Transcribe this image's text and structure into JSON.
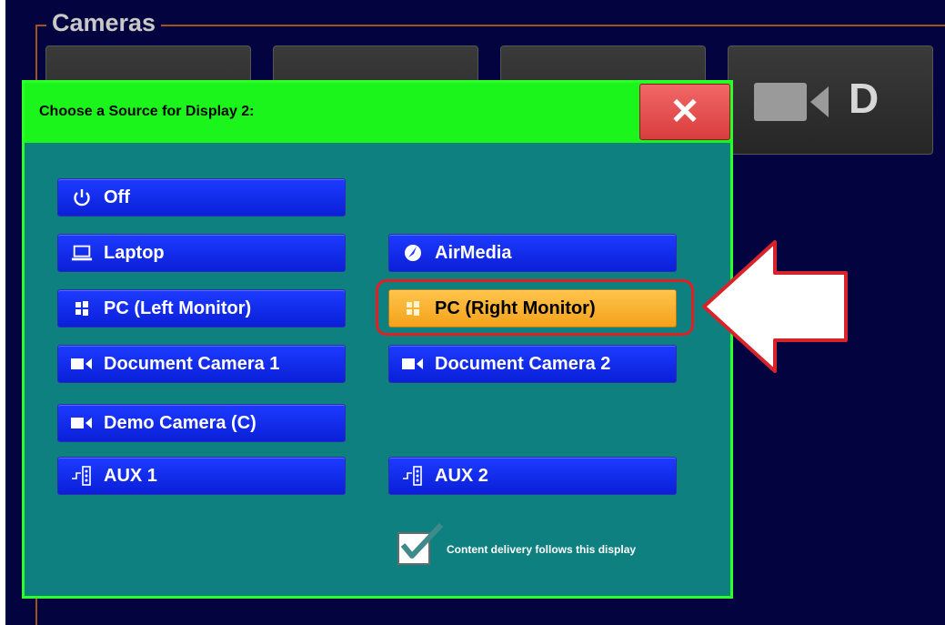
{
  "cameras_group": {
    "title": "Cameras",
    "tiles": [
      {
        "label": ""
      },
      {
        "label": ""
      },
      {
        "label": ""
      },
      {
        "label": "D"
      }
    ]
  },
  "dialog": {
    "title": "Choose a Source for Display 2:",
    "close_label": "✕",
    "sources": [
      {
        "label": "Off",
        "icon": "power-icon"
      },
      {
        "label": "Laptop",
        "icon": "laptop-icon"
      },
      {
        "label": "AirMedia",
        "icon": "airmedia-icon"
      },
      {
        "label": "PC (Left Monitor)",
        "icon": "windows-icon"
      },
      {
        "label": "PC (Right Monitor)",
        "icon": "windows-icon",
        "selected": true
      },
      {
        "label": "Document Camera 1",
        "icon": "camera-icon"
      },
      {
        "label": "Document Camera 2",
        "icon": "camera-icon"
      },
      {
        "label": "Demo Camera (C)",
        "icon": "camera-icon"
      },
      {
        "label": "AUX 1",
        "icon": "aux-icon"
      },
      {
        "label": "AUX 2",
        "icon": "aux-icon"
      }
    ],
    "content_delivery": {
      "label": "Content delivery follows this display",
      "checked": true
    }
  },
  "colors": {
    "background": "#03033f",
    "dialog": "#0e8080",
    "header": "#1cf51c",
    "button": "#1d3bff",
    "selected": "#f4a21c",
    "close": "#e04a4a",
    "highlight": "#e01f27"
  }
}
